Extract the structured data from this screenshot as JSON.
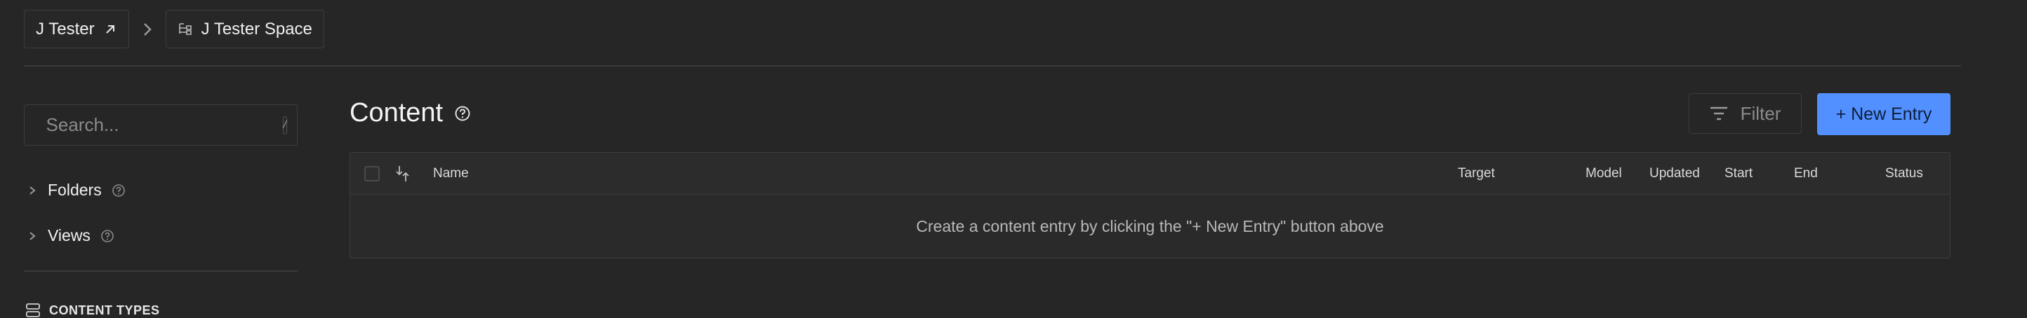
{
  "breadcrumbs": [
    {
      "label": "J Tester"
    },
    {
      "label": "J Tester Space"
    }
  ],
  "sidebar": {
    "search_placeholder": "Search...",
    "search_shortcut": "/",
    "sections": [
      {
        "label": "Folders"
      },
      {
        "label": "Views"
      }
    ],
    "content_types_label": "CONTENT TYPES"
  },
  "main": {
    "title": "Content",
    "filter_label": "Filter",
    "new_entry_label": "+ New Entry",
    "columns": [
      "Name",
      "Target",
      "Model",
      "Updated",
      "Start",
      "End",
      "Status"
    ],
    "empty_message": "Create a content entry by clicking the \"+ New Entry\" button above"
  },
  "colors": {
    "background": "#262626",
    "border": "#3d3d3d",
    "accent": "#5290ff"
  }
}
